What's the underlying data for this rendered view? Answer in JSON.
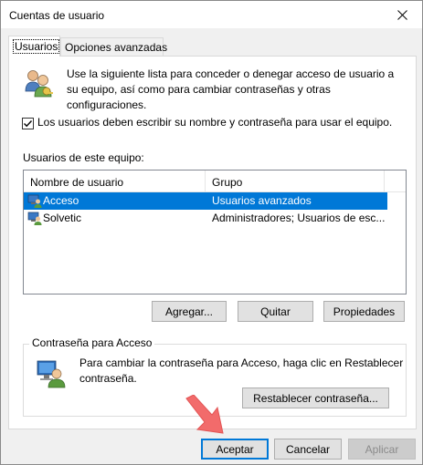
{
  "window": {
    "title": "Cuentas de usuario"
  },
  "tabs": [
    {
      "label": "Usuarios",
      "active": true
    },
    {
      "label": "Opciones avanzadas",
      "active": false
    }
  ],
  "intro_text": "Use la siguiente lista para conceder o denegar acceso de usuario a su equipo, así como para cambiar contraseñas y otras configuraciones.",
  "login_checkbox": {
    "label": "Los usuarios deben escribir su nombre y contraseña para usar el equipo.",
    "checked": true
  },
  "users_list": {
    "label": "Usuarios de este equipo:",
    "columns": [
      "Nombre de usuario",
      "Grupo"
    ],
    "rows": [
      {
        "name": "Acceso",
        "group": "Usuarios avanzados",
        "selected": true
      },
      {
        "name": "Solvetic",
        "group": "Administradores; Usuarios de esc...",
        "selected": false
      }
    ]
  },
  "list_buttons": {
    "add": "Agregar...",
    "remove": "Quitar",
    "properties": "Propiedades"
  },
  "password_group": {
    "label": "Contraseña para Acceso",
    "text": "Para cambiar la contraseña para Acceso, haga clic en Restablecer contraseña.",
    "reset_button": "Restablecer contraseña..."
  },
  "dialog_buttons": {
    "ok": "Aceptar",
    "cancel": "Cancelar",
    "apply": "Aplicar"
  },
  "colors": {
    "selection": "#0078d7",
    "checkbox_accent": "#0078d7",
    "pointer_arrow": "#f26b6b"
  },
  "icons": [
    "close-icon",
    "users-icon",
    "user-account-icon",
    "account-password-icon",
    "pointer-arrow-icon"
  ]
}
